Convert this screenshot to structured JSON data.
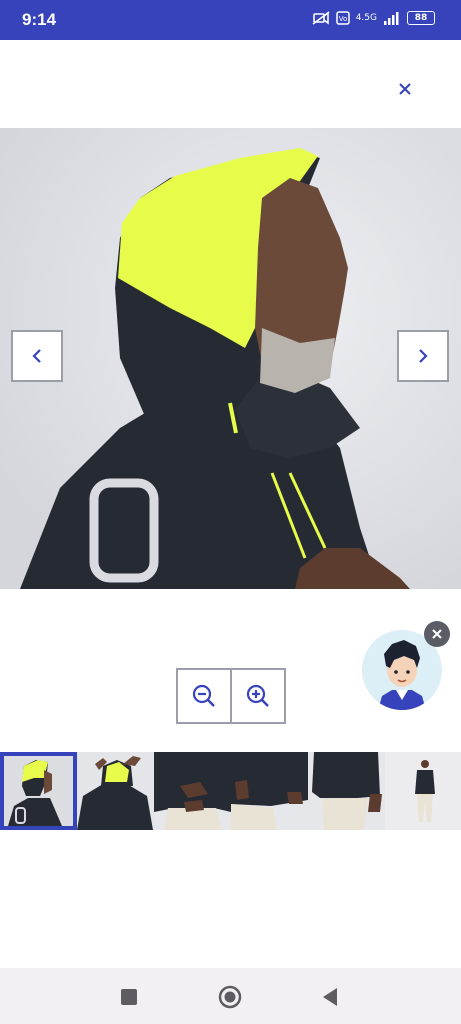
{
  "status_bar": {
    "time": "9:14",
    "network": "4.5G",
    "battery": "88",
    "background": "#3643ba"
  },
  "viewer": {
    "close_icon": "close-icon",
    "prev_icon": "chevron-left-icon",
    "next_icon": "chevron-right-icon",
    "zoom_out_icon": "zoom-out-icon",
    "zoom_in_icon": "zoom-in-icon",
    "accent_color": "#3643ba",
    "hood_color": "#e6fb4a",
    "jacket_color": "#262a33"
  },
  "thumbnails": {
    "count": 6,
    "selected_index": 0
  },
  "assistant": {
    "icon": "assistant-avatar-icon",
    "close_icon": "close-icon"
  },
  "system_nav": {
    "recents_icon": "square-icon",
    "home_icon": "circle-icon",
    "back_icon": "triangle-back-icon"
  }
}
